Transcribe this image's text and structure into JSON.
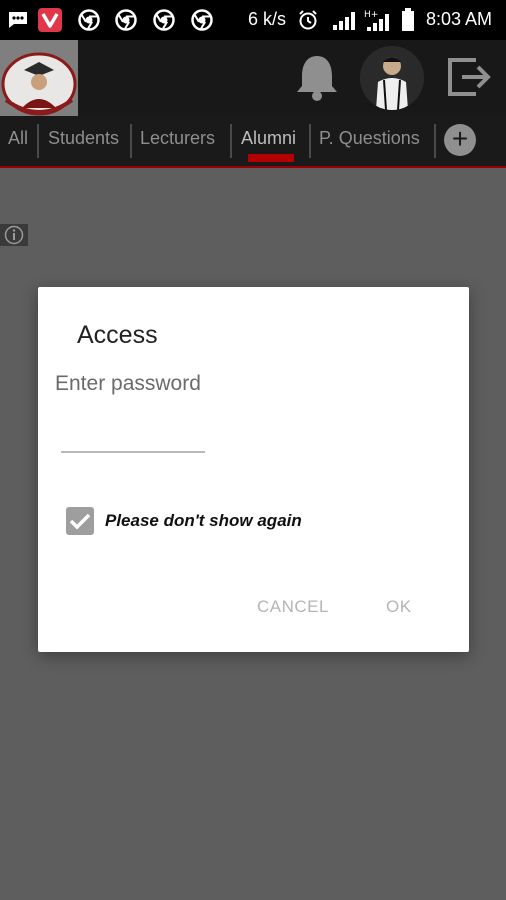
{
  "status_bar": {
    "network_speed": "6 k/s",
    "time": "8:03 AM",
    "notification_icons": [
      "message-icon",
      "vivaldi-app-icon",
      "chrome-icon",
      "chrome-icon",
      "chrome-icon",
      "chrome-icon"
    ],
    "system_icons": [
      "alarm-icon",
      "signal-icon",
      "signal-hplus-icon",
      "battery-icon"
    ]
  },
  "app_bar": {
    "logo": "school-logo",
    "icons": [
      "bell-icon",
      "profile-avatar",
      "logout-icon"
    ]
  },
  "tabs": {
    "items": [
      {
        "label": "All"
      },
      {
        "label": "Students"
      },
      {
        "label": "Lecturers"
      },
      {
        "label": "Alumni"
      },
      {
        "label": "P. Questions"
      }
    ],
    "active": "Alumni",
    "add_icon": "plus-circle-icon"
  },
  "info_icon": "info-icon",
  "dialog": {
    "title": "Access",
    "prompt": "Enter password",
    "password_value": "",
    "checkbox_label": "Please don't show again",
    "checkbox_checked": true,
    "cancel_label": "CANCEL",
    "ok_label": "OK"
  },
  "colors": {
    "accent_red": "#b40000",
    "app_bar_bg": "#181818",
    "overlay_bg": "#5e5e5e",
    "dialog_bg": "#ffffff",
    "button_text": "#b5b5b5"
  }
}
